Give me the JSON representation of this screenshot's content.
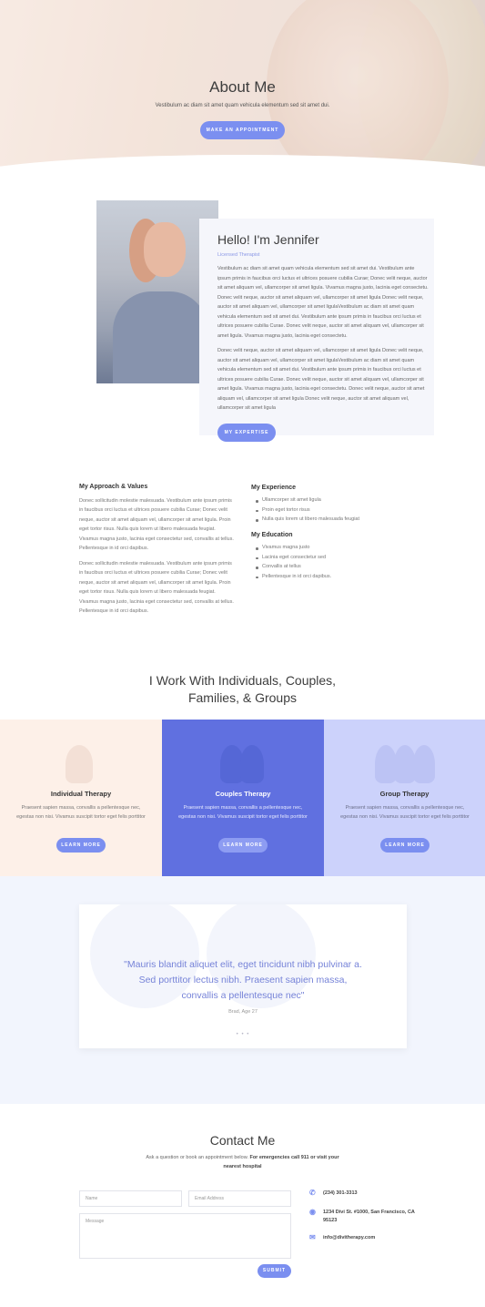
{
  "hero": {
    "title": "About Me",
    "subtitle": "Vestibulum ac diam sit amet quam vehicula elementum sed sit amet dui.",
    "button": "MAKE AN APPOINTMENT"
  },
  "intro": {
    "heading": "Hello! I'm Jennifer",
    "role": "Licensed Therapist",
    "paragraph1": "Vestibulum ac diam sit amet quam vehicula elementum sed sit amet dui. Vestibulum ante ipsum primis in faucibus orci luctus et ultrices posuere cubilia Curae; Donec velit neque, auctor sit amet aliquam vel, ullamcorper sit amet ligula. Vivamus magna justo, lacinia eget consectetu. Donec velit neque, auctor sit amet aliquam vel, ullamcorper sit amet ligula Donec velit neque, auctor sit amet aliquam vel, ullamcorper sit amet ligulaVestibulum ac diam sit amet quam vehicula elementum sed sit amet dui. Vestibulum ante ipsum primis in faucibus orci luctus et ultrices posuere cubilia Curae. Donec velit neque, auctor sit amet aliquam vel, ullamcorper sit amet ligula. Vivamus magna justo, lacinia eget consectetu.",
    "paragraph2": "Donec velit neque, auctor sit amet aliquam vel, ullamcorper sit amet ligula Donec velit neque, auctor sit amet aliquam vel, ullamcorper sit amet ligulaVestibulum ac diam sit amet quam vehicula elementum sed sit amet dui. Vestibulum ante ipsum primis in faucibus orci luctus et ultrices posuere cubilia Curae. Donec velit neque, auctor sit amet aliquam vel, ullamcorper sit amet ligula. Vivamus magna justo, lacinia eget consectetu. Donec velit neque, auctor sit amet aliquam vel, ullamcorper sit amet ligula Donec velit neque, auctor sit amet aliquam vel, ullamcorper sit amet ligula",
    "button": "MY EXPERTISE"
  },
  "approach": {
    "title": "My Approach & Values",
    "paragraph1": "Donec sollicitudin molestie malesuada. Vestibulum ante ipsum primis in faucibus orci luctus et ultrices posuere cubilia Curae; Donec velit neque, auctor sit amet aliquam vel, ullamcorper sit amet ligula. Proin eget tortor risus. Nulla quis lorem ut libero malesuada feugiat. Vivamus magna justo, lacinia eget consectetur sed, convallis at tellus. Pellentesque in id orci dapibus.",
    "paragraph2": "Donec sollicitudin molestie malesuada. Vestibulum ante ipsum primis in faucibus orci luctus et ultrices posuere cubilia Curae; Donec velit neque, auctor sit amet aliquam vel, ullamcorper sit amet ligula. Proin eget tortor risus. Nulla quis lorem ut libero malesuada feugiat. Vivamus magna justo, lacinia eget consectetur sed, convallis at tellus. Pellentesque in id orci dapibus."
  },
  "experience": {
    "title": "My Experience",
    "items": [
      "Ullamcorper sit amet ligula",
      "Proin eget tortor risus",
      "Nulla quis lorem ut libero malesuada feugiat"
    ]
  },
  "education": {
    "title": "My Education",
    "items": [
      "Vivamus magna justo",
      "Lacinia eget consectetur sed",
      "Convallis at tellus",
      "Pellentesque in id orci dapibus."
    ]
  },
  "services": {
    "title_line1": "I Work With Individuals, Couples,",
    "title_line2": "Families, & Groups",
    "items": [
      {
        "title": "Individual Therapy",
        "text": "Praesent sapien massa, convallis a pellentesque nec, egestas non nisi. Vivamus suscipit tortor eget felis porttitor",
        "button": "LEARN MORE",
        "bg": "#fdf0e8"
      },
      {
        "title": "Couples Therapy",
        "text": "Praesent sapien massa, convallis a pellentesque nec, egestas non nisi. Vivamus suscipit tortor eget felis porttitor",
        "button": "LEARN MORE",
        "bg": "#6070e0"
      },
      {
        "title": "Group Therapy",
        "text": "Praesent sapien massa, convallis a pellentesque nec, egestas non nisi. Vivamus suscipit tortor eget felis porttitor",
        "button": "LEARN MORE",
        "bg": "#ccd2fb"
      }
    ]
  },
  "testimonial": {
    "quote": "\"Mauris blandit aliquet elit, eget tincidunt nibh pulvinar a. Sed porttitor lectus nibh. Praesent sapien massa, convallis a pellentesque nec\"",
    "author": "Brad, Age 27",
    "dots": "• • •"
  },
  "contact": {
    "title": "Contact Me",
    "sub_plain": "Ask a question or book an appointment below. ",
    "sub_bold": "For emergencies call 911 or visit your nearest hospital",
    "name_placeholder": "Name",
    "email_placeholder": "Email Address",
    "message_placeholder": "Message",
    "submit": "SUBMIT",
    "phone": "(234) 301-3313",
    "address": "1234 Divi St. #1000, San Francisco, CA 95123",
    "email": "info@divitherapy.com"
  },
  "accent_color": "#7b8ff0"
}
